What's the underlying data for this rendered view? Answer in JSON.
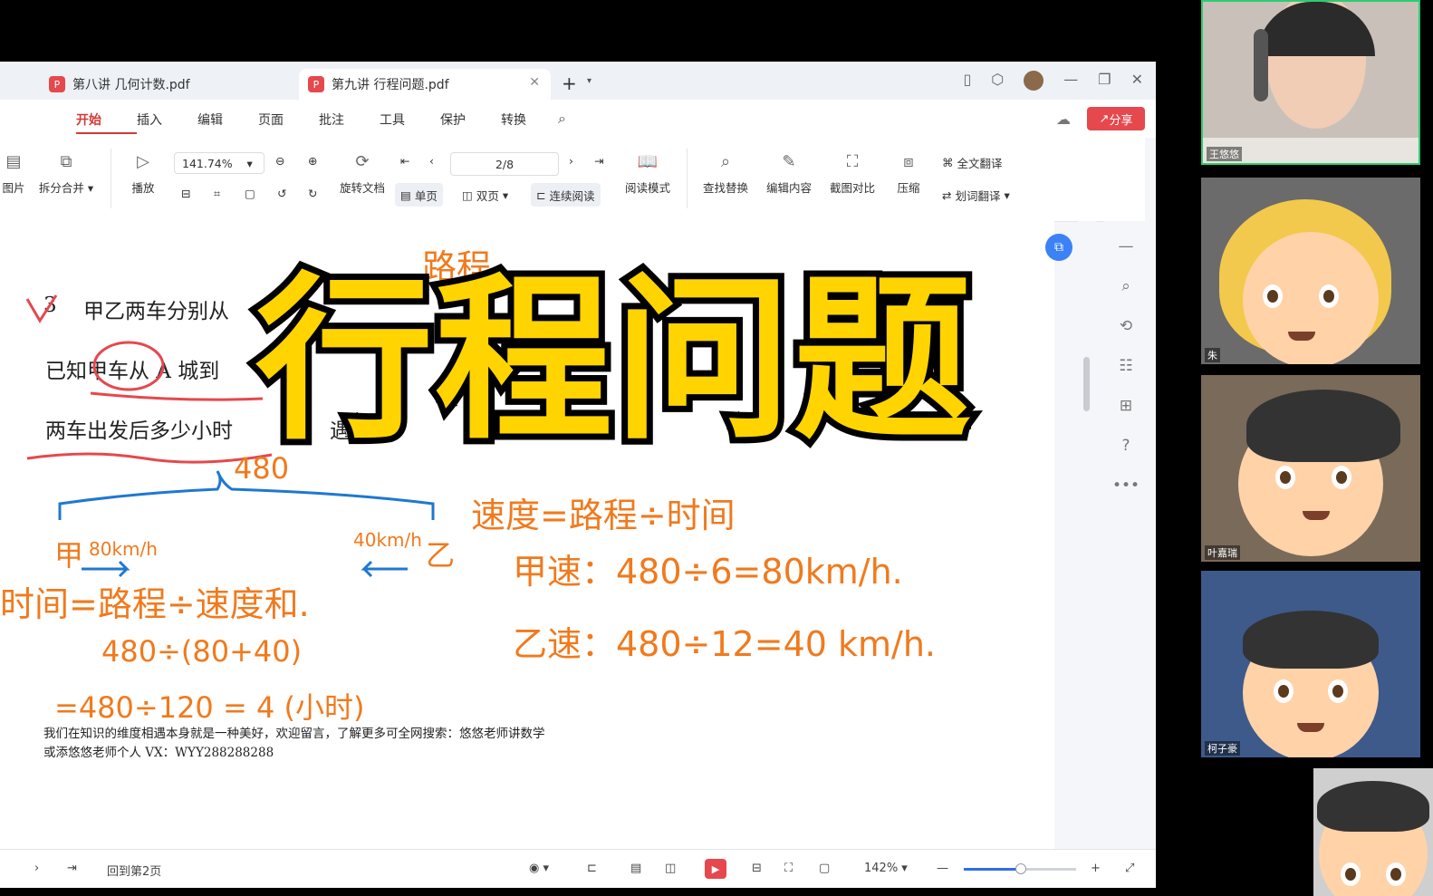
{
  "tabs": [
    {
      "label": "第八讲 几何计数.pdf",
      "active": false
    },
    {
      "label": "第九讲 行程问题.pdf",
      "active": true
    }
  ],
  "menu": [
    "开始",
    "插入",
    "编辑",
    "页面",
    "批注",
    "工具",
    "保护",
    "转换"
  ],
  "share_label": "分享",
  "toolbar": {
    "zoom": "141.74%",
    "page": "2/8",
    "row1": {
      "img": "图片",
      "split_merge": "拆分合并",
      "play": "播放",
      "rotate": "旋转文档",
      "single": "单页",
      "double": "双页",
      "continuous": "连续阅读",
      "read_mode": "阅读模式",
      "find_replace": "查找替换",
      "edit_content": "编辑内容",
      "screenshot_compare": "截图对比",
      "compress": "压缩",
      "full_translate": "全文翻译",
      "word_translate": "划词翻译"
    }
  },
  "document": {
    "q_number": "3",
    "line1": "甲乙两车分别从",
    "line2": "已知甲车从 A 城到",
    "line3": "两车出发后多少小时",
    "line3_end": "遇？",
    "footer1": "我们在知识的维度相遇本身就是一种美好，欢迎留言，了解更多可全网搜索：悠悠老师讲数学",
    "footer2": "或添悠悠老师个人 VX：WYY288288288"
  },
  "handwriting": {
    "distance": "路程.",
    "total": "480",
    "jia": "甲",
    "jia_speed": "80km/h",
    "yi_speed": "40km/h",
    "yi": "乙",
    "time_formula": "时间=路程÷速度和.",
    "calc1": "480÷(80+40)",
    "calc2": "=480÷120   =  4 (小时)",
    "speed_formula": "速度=路程÷时间",
    "jia_calc": "甲速：480÷6=80km/h.",
    "yi_calc": "乙速：480÷12=40 km/h."
  },
  "overlay_title": "行程问题",
  "statusbar": {
    "back_to_page": "回到第2页",
    "zoom": "142%",
    "zoom_fraction": 0.5
  },
  "participants": [
    {
      "name": "王悠悠"
    },
    {
      "name": "朱"
    },
    {
      "name": "叶嘉瑞"
    },
    {
      "name": "柯子豪"
    },
    {
      "name": ""
    }
  ],
  "colors": {
    "accent": "#d23a36",
    "handwriting": "#f07a1d",
    "overlay_fill": "#ffd400"
  }
}
